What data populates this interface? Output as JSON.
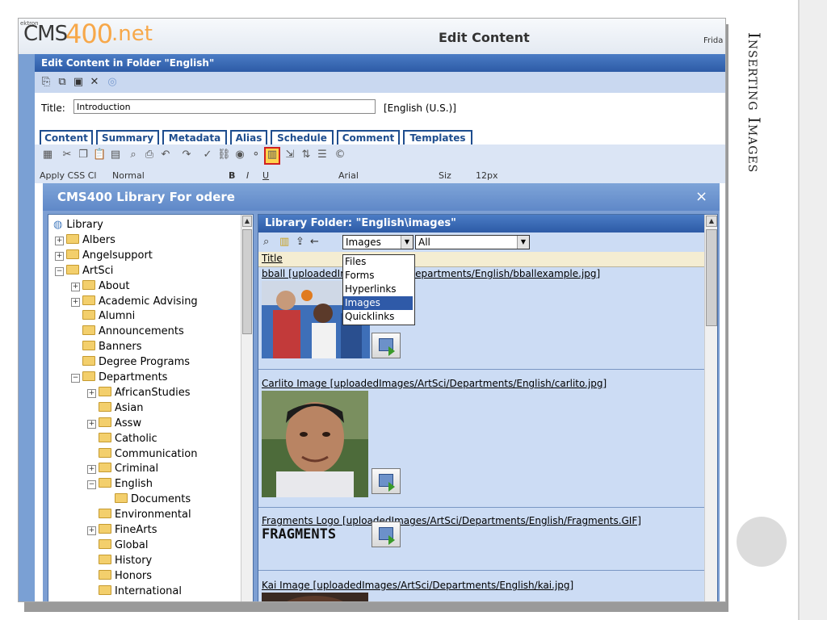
{
  "slide": {
    "heading": "Inserting Images"
  },
  "app": {
    "brand_small": "ektron",
    "brand_cms": "CMS",
    "brand_400": "400",
    "brand_net": ".net",
    "title": "Edit Content",
    "header_right": "Frida"
  },
  "folder_bar": "Edit Content in Folder \"English\"",
  "title_row": {
    "label": "Title:",
    "value": "Introduction",
    "language": "[English (U.S.)]"
  },
  "tabs": [
    "Content",
    "Summary",
    "Metadata",
    "Alias",
    "Schedule",
    "Comment",
    "Templates"
  ],
  "editor": {
    "css_class": "Apply CSS Cl",
    "style": "Normal",
    "font": "Arial",
    "size_label": "Siz",
    "size_value": "12px"
  },
  "dialog": {
    "title": "CMS400 Library For odere",
    "close_glyph": "×"
  },
  "tree": {
    "items": [
      {
        "label": "Library",
        "indent": 0,
        "toggle": "",
        "root": true
      },
      {
        "label": "Albers",
        "indent": 1,
        "toggle": "+"
      },
      {
        "label": "Angelsupport",
        "indent": 1,
        "toggle": "+"
      },
      {
        "label": "ArtSci",
        "indent": 1,
        "toggle": "−"
      },
      {
        "label": "About",
        "indent": 2,
        "toggle": "+"
      },
      {
        "label": "Academic Advising",
        "indent": 2,
        "toggle": "+"
      },
      {
        "label": "Alumni",
        "indent": 2,
        "toggle": ""
      },
      {
        "label": "Announcements",
        "indent": 2,
        "toggle": ""
      },
      {
        "label": "Banners",
        "indent": 2,
        "toggle": ""
      },
      {
        "label": "Degree Programs",
        "indent": 2,
        "toggle": ""
      },
      {
        "label": "Departments",
        "indent": 2,
        "toggle": "−"
      },
      {
        "label": "AfricanStudies",
        "indent": 3,
        "toggle": "+"
      },
      {
        "label": "Asian",
        "indent": 3,
        "toggle": ""
      },
      {
        "label": "Assw",
        "indent": 3,
        "toggle": "+"
      },
      {
        "label": "Catholic",
        "indent": 3,
        "toggle": ""
      },
      {
        "label": "Communication",
        "indent": 3,
        "toggle": ""
      },
      {
        "label": "Criminal",
        "indent": 3,
        "toggle": "+"
      },
      {
        "label": "English",
        "indent": 3,
        "toggle": "−"
      },
      {
        "label": "Documents",
        "indent": 4,
        "toggle": ""
      },
      {
        "label": "Environmental",
        "indent": 3,
        "toggle": ""
      },
      {
        "label": "FineArts",
        "indent": 3,
        "toggle": "+"
      },
      {
        "label": "Global",
        "indent": 3,
        "toggle": ""
      },
      {
        "label": "History",
        "indent": 3,
        "toggle": ""
      },
      {
        "label": "Honors",
        "indent": 3,
        "toggle": ""
      },
      {
        "label": "International",
        "indent": 3,
        "toggle": ""
      }
    ]
  },
  "library": {
    "header": "Library Folder: \"English\\images\"",
    "type_select": "Images",
    "filter_select": "All",
    "column_title": "Title",
    "dropdown_options": [
      "Files",
      "Forms",
      "Hyperlinks",
      "Images",
      "Quicklinks"
    ],
    "selected_option": "Images",
    "items": [
      {
        "label": "bball [uploadedImages/ArtSci/Departments/English/bballexample.jpg]"
      },
      {
        "label": "Carlito Image [uploadedImages/ArtSci/Departments/English/carlito.jpg]"
      },
      {
        "label": "Fragments Logo [uploadedImages/ArtSci/Departments/English/Fragments.GIF]"
      },
      {
        "label": "Kai Image [uploadedImages/ArtSci/Departments/English/kai.jpg]"
      }
    ],
    "fragments_logo_text": "FRAGMENTS"
  },
  "colors": {
    "header_blue": "#2d5ba6",
    "dialog_blue": "#7d9fd3",
    "accent_orange": "#f7a84a",
    "highlight_red": "#d02020"
  }
}
